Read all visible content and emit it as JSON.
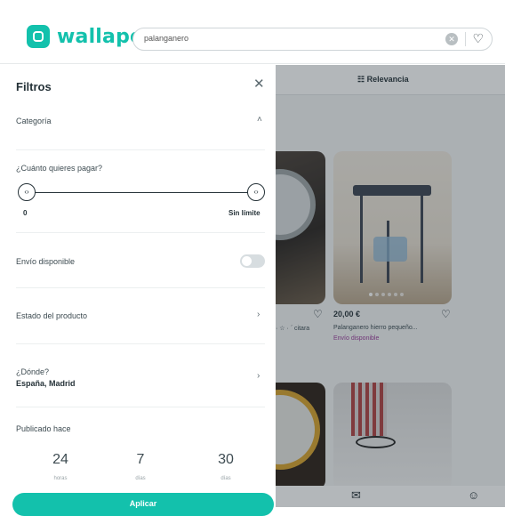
{
  "header": {
    "logo_text": "wallapop",
    "search_value": "palanganero"
  },
  "listing": {
    "sort_label": "☷ Relevancia",
    "items": [
      {
        "desc": "· ☆ · ˊ citara"
      },
      {
        "price": "20,00 €",
        "desc": "Palanganero hierro pequeño...",
        "shipping": "Envío disponible"
      }
    ]
  },
  "filters": {
    "title": "Filtros",
    "category_label": "Categoría",
    "price_question": "¿Cuánto quieres pagar?",
    "price_min": "0",
    "price_max": "Sin límite",
    "shipping_label": "Envío disponible",
    "condition_label": "Estado del producto",
    "location_question": "¿Dónde?",
    "location_value": "España, Madrid",
    "published_label": "Publicado hace",
    "days_options": [
      {
        "value": "24",
        "unit": "horas"
      },
      {
        "value": "7",
        "unit": "días"
      },
      {
        "value": "30",
        "unit": "días"
      }
    ],
    "apply_label": "Aplicar"
  },
  "colors": {
    "brand": "#13c1ac",
    "text": "#253238"
  },
  "icons": [
    "logo-icon",
    "clear-icon",
    "heart-icon",
    "close-icon",
    "chevron-up-icon",
    "chevron-right-icon",
    "mail-icon",
    "smile-icon",
    "sort-icon"
  ]
}
